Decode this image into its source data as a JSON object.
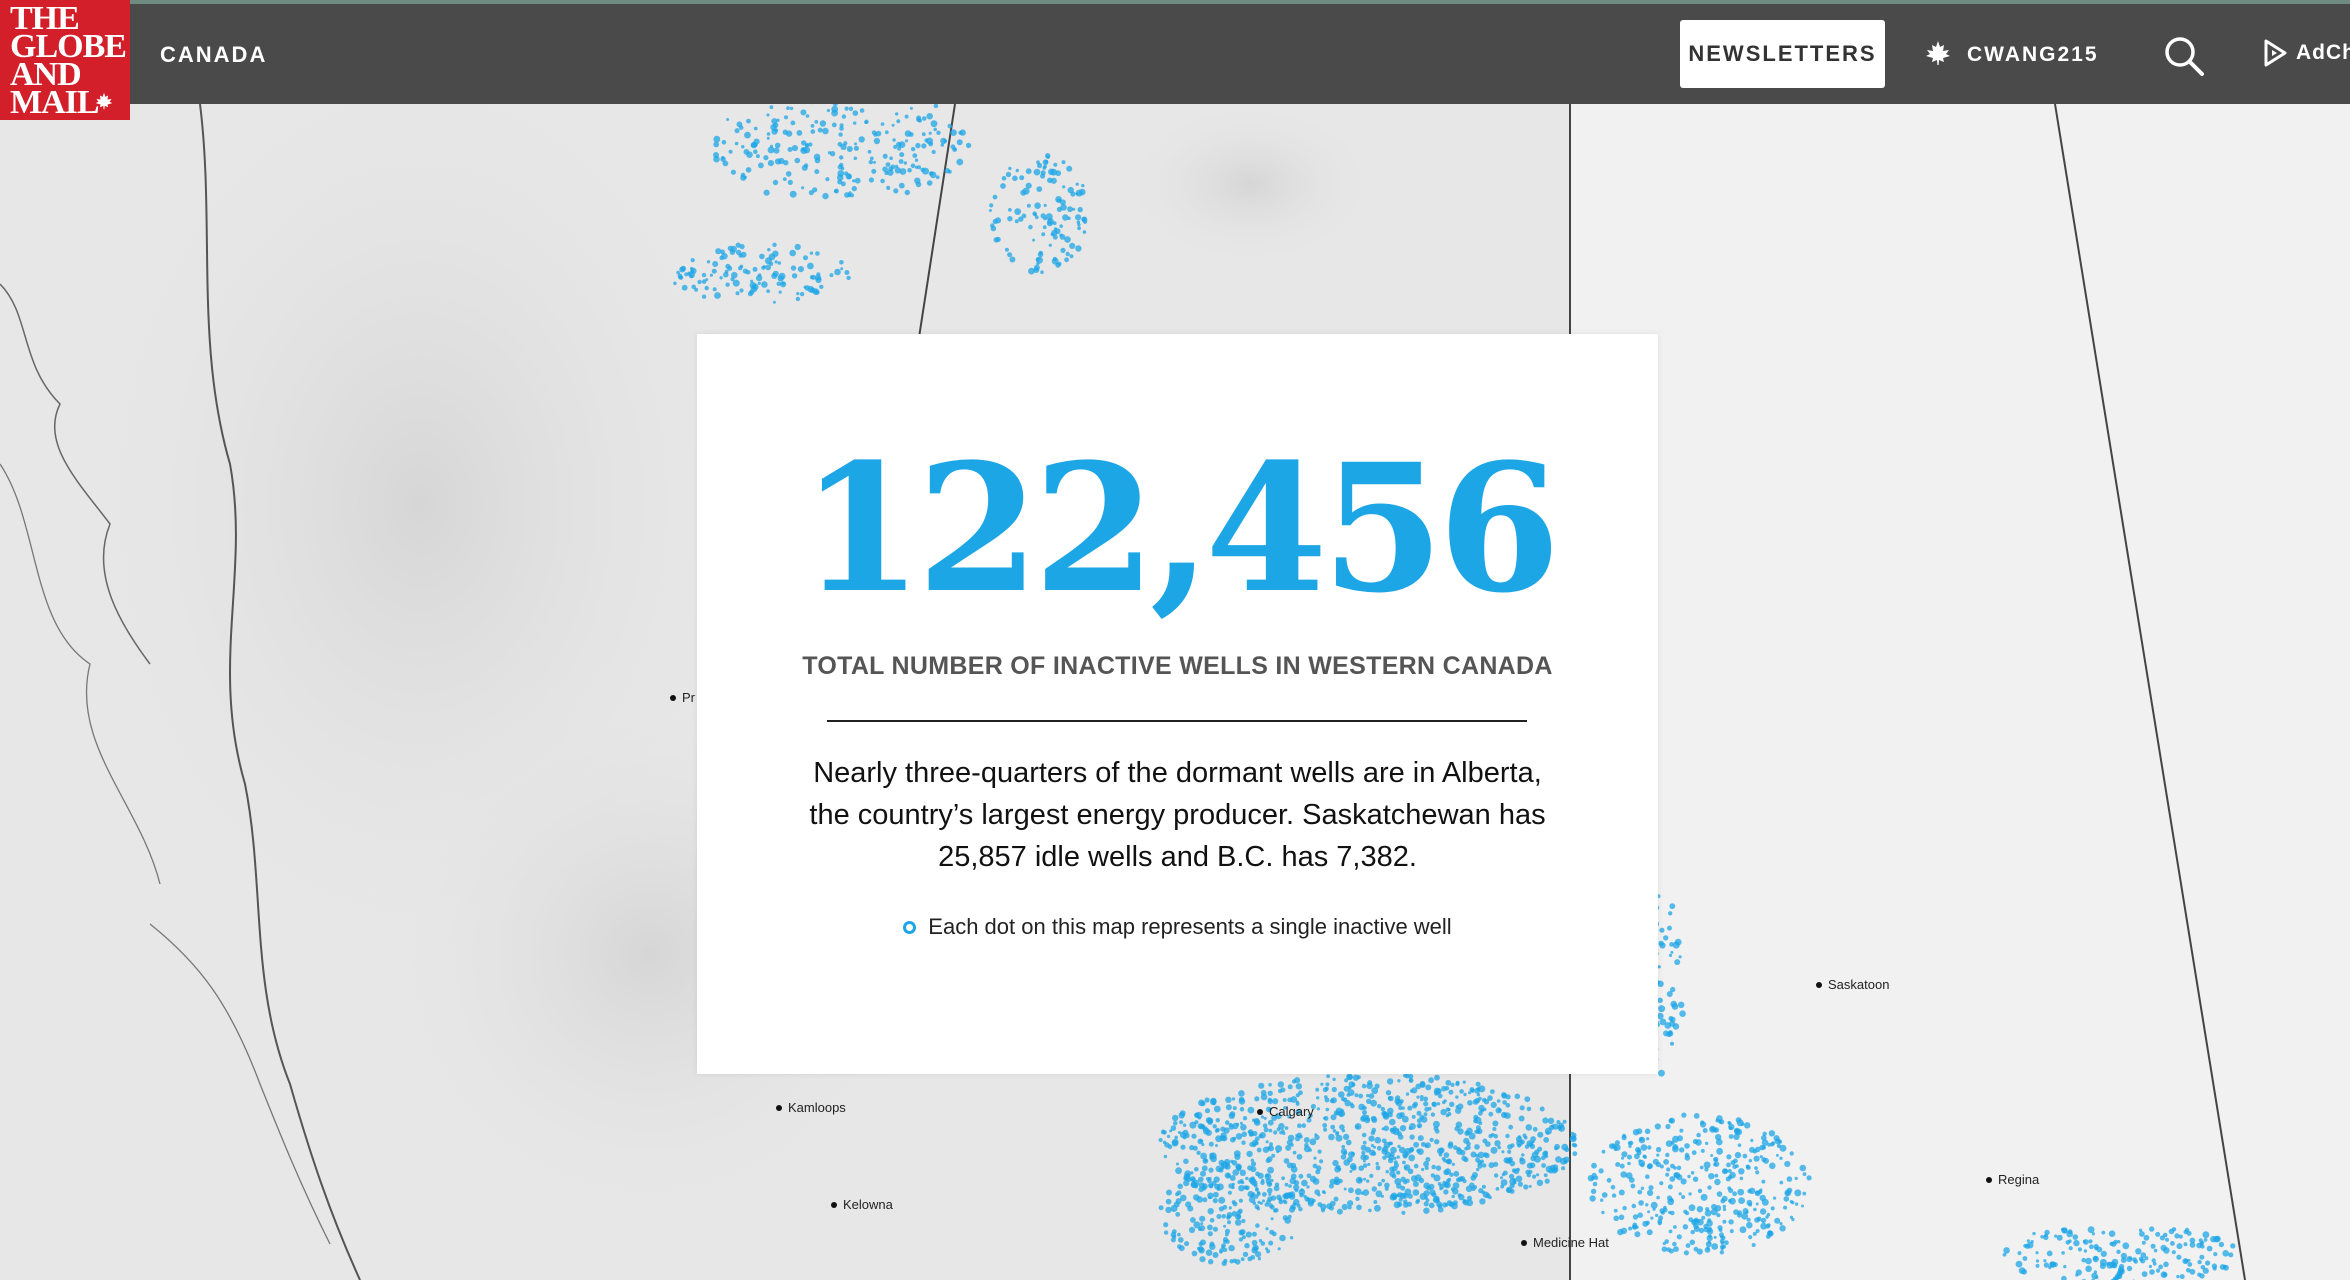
{
  "header": {
    "logo_lines": [
      "THE",
      "GLOBE",
      "AND",
      "MAIL"
    ],
    "section": "CANADA",
    "newsletters": "NEWSLETTERS",
    "account": "CWANG215",
    "adchoices": "AdCh",
    "icons": [
      "maple-leaf-icon",
      "search-icon",
      "adchoices-icon"
    ]
  },
  "card": {
    "number": "122,456",
    "subtitle": "TOTAL NUMBER OF INACTIVE WELLS IN WESTERN CANADA",
    "body": "Nearly three-quarters of the dormant wells are in Alberta, the country’s largest energy producer. Saskatchewan has 25,857 idle wells and B.C. has 7,382.",
    "legend": "Each dot on this map represents a single inactive well"
  },
  "map": {
    "cities": [
      "Pr",
      "Saskatoon",
      "Kamloops",
      "Calgary",
      "Regina",
      "Kelowna",
      "Medicine Hat"
    ]
  },
  "colors": {
    "accent": "#1da6e6",
    "nav": "#4a4a4a",
    "logo": "#d21f2a"
  }
}
